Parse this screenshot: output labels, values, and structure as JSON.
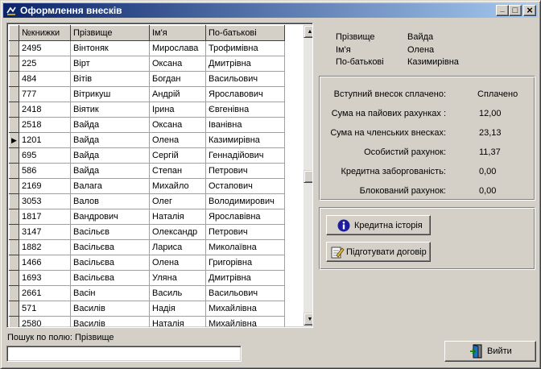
{
  "window": {
    "title": "Оформлення внесків",
    "minimize_glyph": "_",
    "maximize_glyph": "□",
    "close_glyph": "×"
  },
  "grid": {
    "columns": [
      "№книжки",
      "Прізвище",
      "Ім'я",
      "По-батькові"
    ],
    "current_row_marker": "▶",
    "selected_row_index": 7,
    "rows": [
      [
        "2495",
        "Вінтоняк",
        "Мирослава",
        "Трофимівна"
      ],
      [
        "225",
        "Вірт",
        "Оксана",
        "Дмитрівна"
      ],
      [
        "484",
        "Вітів",
        "Богдан",
        "Васильович"
      ],
      [
        "777",
        "Вітрикуш",
        "Андрій",
        "Ярославович"
      ],
      [
        "2418",
        "Віятик",
        "Ірина",
        "Євгенівна"
      ],
      [
        "2518",
        "Вайда",
        "Оксана",
        "Іванівна"
      ],
      [
        "1201",
        "Вайда",
        "Олена",
        "Казимирівна"
      ],
      [
        "695",
        "Вайда",
        "Сергій",
        "Геннадійович"
      ],
      [
        "586",
        "Вайда",
        "Степан",
        "Петрович"
      ],
      [
        "2169",
        "Валага",
        "Михайло",
        "Остапович"
      ],
      [
        "3053",
        "Валов",
        "Олег",
        "Володимирович"
      ],
      [
        "1817",
        "Вандрович",
        "Наталія",
        "Ярославівна"
      ],
      [
        "3147",
        "Васільєв",
        "Олександр",
        "Петрович"
      ],
      [
        "1882",
        "Васільєва",
        "Лариса",
        "Миколаївна"
      ],
      [
        "1466",
        "Васільєва",
        "Олена",
        "Григорівна"
      ],
      [
        "1693",
        "Васільєва",
        "Уляна",
        "Дмитрівна"
      ],
      [
        "2661",
        "Васін",
        "Василь",
        "Васильович"
      ],
      [
        "571",
        "Василів",
        "Надія",
        "Михайлівна"
      ],
      [
        "2580",
        "Василів",
        "Наталія",
        "Михайлівна"
      ]
    ],
    "scroll_up_glyph": "▲",
    "scroll_down_glyph": "▼"
  },
  "person": {
    "surname_label": "Прізвище",
    "surname": "Вайда",
    "name_label": "Ім'я",
    "name": "Олена",
    "patronymic_label": "По-батькові",
    "patronymic": "Казимирівна"
  },
  "balances": {
    "entry_fee_label": "Вступний внесок сплачено:",
    "entry_fee_value": "Сплачено",
    "share_accounts_label": "Сума на пайових рахунках :",
    "share_accounts_value": "12,00",
    "member_contrib_label": "Сума на членських внесках:",
    "member_contrib_value": "23,13",
    "personal_account_label": "Особистий рахунок:",
    "personal_account_value": "11,37",
    "credit_debt_label": "Кредитна заборгованість:",
    "credit_debt_value": "0,00",
    "blocked_account_label": "Блокований рахунок:",
    "blocked_account_value": "0,00"
  },
  "actions": {
    "credit_history_label": "Кредитна історія",
    "prepare_contract_label": "Підготувати договір",
    "exit_label": "Вийти"
  },
  "search": {
    "label": "Пошук по полю: Прізвище",
    "value": ""
  },
  "colors": {
    "title_active": "#0a246a",
    "title_gradient_end": "#a6caf0",
    "face": "#d4d0c8"
  }
}
